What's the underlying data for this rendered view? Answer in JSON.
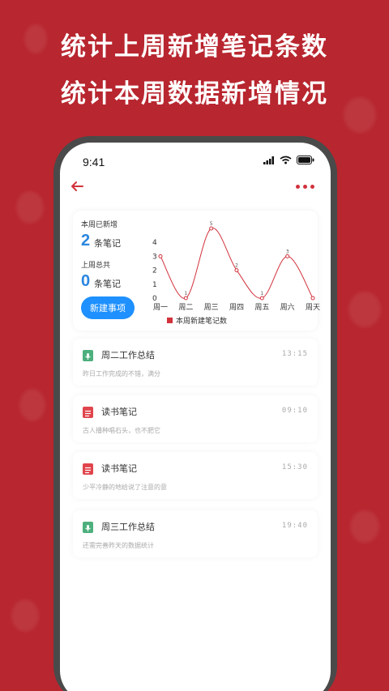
{
  "promo": {
    "line1": "统计上周新增笔记条数",
    "line2": "统计本周数据新增情况"
  },
  "status_bar": {
    "time": "9:41"
  },
  "stats": {
    "this_week_label": "本周已新增",
    "this_week_count": "2",
    "this_week_unit": "条笔记",
    "last_week_label": "上周总共",
    "last_week_count": "0",
    "last_week_unit": "条笔记",
    "new_button_label": "新建事项"
  },
  "chart_data": {
    "type": "line",
    "categories": [
      "周一",
      "周二",
      "周三",
      "周四",
      "周五",
      "周六",
      "周天"
    ],
    "series": [
      {
        "name": "本周新建笔记数",
        "values": [
          3,
          0,
          5,
          2,
          0,
          3,
          0
        ]
      }
    ],
    "point_labels": [
      "",
      "1",
      "5",
      "2",
      "1",
      "3",
      ""
    ],
    "y_ticks": [
      "0",
      "1",
      "2",
      "3",
      "4"
    ],
    "ylim": [
      0,
      5
    ],
    "legend": "bottom",
    "color": "#d2323c"
  },
  "notes": [
    {
      "title": "周二工作总结",
      "time": "13:15",
      "summary": "昨日工作完成的不错，满分",
      "icon": "microphone-icon",
      "color": "#4caf7d"
    },
    {
      "title": "读书笔记",
      "time": "09:10",
      "summary": "古人播种唱石头，也不肥它",
      "icon": "document-icon",
      "color": "#e0454c"
    },
    {
      "title": "读书笔记",
      "time": "15:30",
      "summary": "少平冷静的地给说了注意的意",
      "icon": "document-icon",
      "color": "#e0454c"
    },
    {
      "title": "周三工作总结",
      "time": "19:40",
      "summary": "还需完善昨天的数据统计",
      "icon": "microphone-icon",
      "color": "#4caf7d"
    }
  ]
}
